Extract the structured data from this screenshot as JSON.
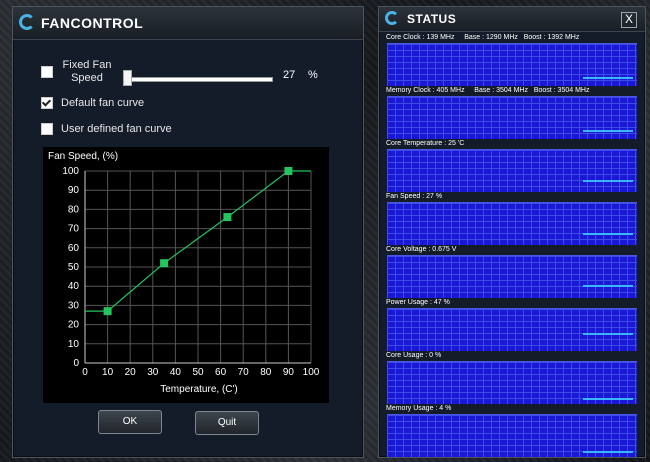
{
  "fancontrol": {
    "title": "FANCONTROL",
    "fixed_fan_label": "Fixed Fan Speed",
    "fixed_fan_checked": false,
    "fixed_fan_value": "27",
    "fixed_fan_unit": "%",
    "default_curve_label": "Default fan curve",
    "default_curve_checked": true,
    "user_curve_label": "User defined fan curve",
    "user_curve_checked": false,
    "ok_label": "OK",
    "quit_label": "Quit"
  },
  "chart_data": {
    "type": "line",
    "title": "Fan Speed, (%)",
    "xlabel": "Temperature, (C')",
    "ylabel": "Fan Speed, (%)",
    "xlim": [
      0,
      100
    ],
    "ylim": [
      0,
      100
    ],
    "xticks": [
      0,
      10,
      20,
      30,
      40,
      50,
      60,
      70,
      80,
      90,
      100
    ],
    "yticks": [
      0,
      10,
      20,
      30,
      40,
      50,
      60,
      70,
      80,
      90,
      100
    ],
    "grid": true,
    "line_color": "#22c55e",
    "series": [
      {
        "x": [
          0,
          10,
          35,
          63,
          90,
          100
        ],
        "y": [
          27,
          27,
          52,
          76,
          100,
          100
        ]
      }
    ],
    "control_points": {
      "x": [
        10,
        35,
        63,
        90
      ],
      "y": [
        27,
        52,
        76,
        100
      ]
    }
  },
  "status": {
    "title": "STATUS",
    "close_label": "X",
    "graph_color": "#1a17d6",
    "items": [
      {
        "label": "Core Clock : 139 MHz     Base : 1290 MHz   Boost : 1392 MHz",
        "level": 0.15
      },
      {
        "label": "Memory Clock : 405 MHz     Base : 3504 MHz   Boost : 3504 MHz",
        "level": 0.15
      },
      {
        "label": "Core Temperature : 25 'C",
        "level": 0.25
      },
      {
        "label": "Fan Speed : 27 %",
        "level": 0.27
      },
      {
        "label": "Core Voltage : 0.675 V",
        "level": 0.3
      },
      {
        "label": "Power Usage : 47 %",
        "level": 0.47
      },
      {
        "label": "Core Usage : 0 %",
        "level": 0.0
      },
      {
        "label": "Memory Usage : 4 %",
        "level": 0.04
      }
    ]
  }
}
